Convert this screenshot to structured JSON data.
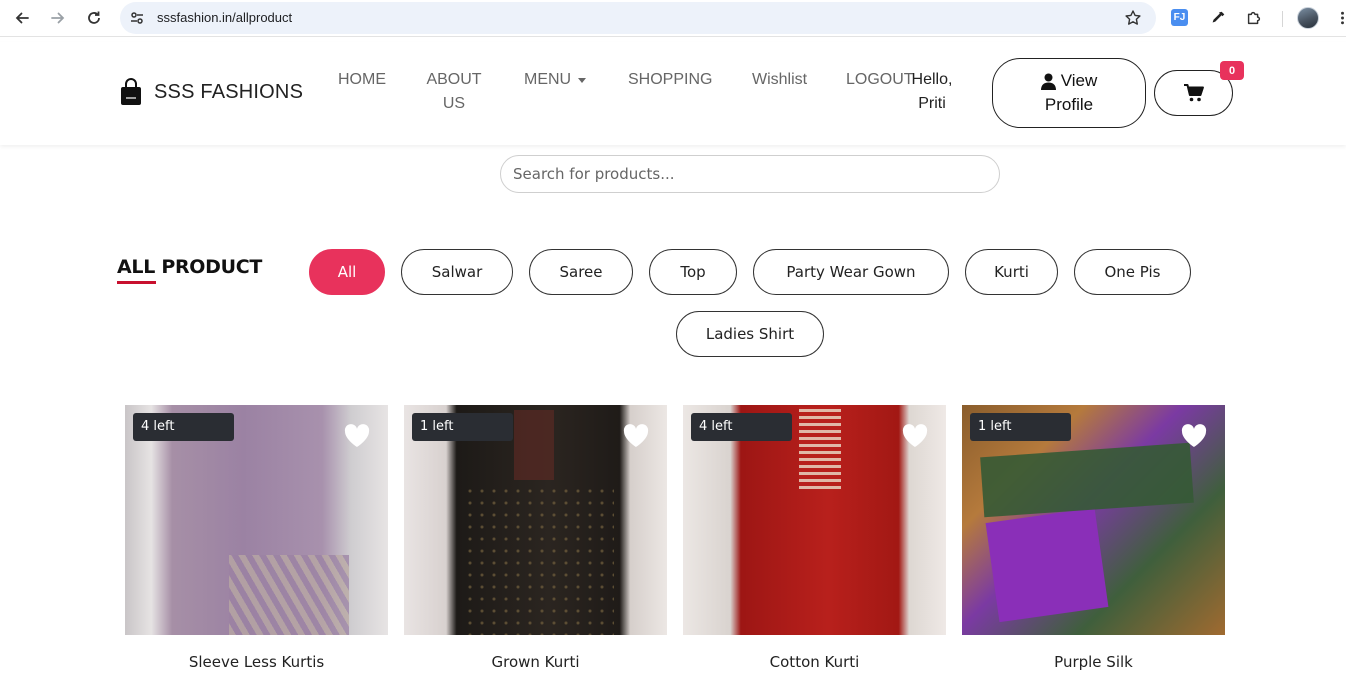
{
  "browser": {
    "url": "sssfashion.in/allproduct",
    "extension_label": "FJ"
  },
  "header": {
    "brand": "SSS FASHIONS",
    "nav": {
      "home": "HOME",
      "about_line1": "ABOUT",
      "about_line2": "US",
      "menu": "MENU",
      "shopping": "SHOPPING",
      "wishlist": "Wishlist",
      "logout": "LOGOUT"
    },
    "greeting_line1": "Hello,",
    "greeting_line2": "Priti",
    "view_profile_line1": "View",
    "view_profile_line2": "Profile",
    "cart_count": "0"
  },
  "search": {
    "placeholder": "Search for products..."
  },
  "section": {
    "title": "ALL PRODUCT"
  },
  "filters": {
    "all": "All",
    "salwar": "Salwar",
    "saree": "Saree",
    "top": "Top",
    "party_wear_gown": "Party Wear Gown",
    "kurti": "Kurti",
    "one_pis": "One Pis",
    "ladies_shirt": "Ladies Shirt",
    "active": "All"
  },
  "products": [
    {
      "stock": "4 left",
      "title": "Sleeve Less Kurtis"
    },
    {
      "stock": "1 left",
      "title": "Grown Kurti"
    },
    {
      "stock": "4 left",
      "title": "Cotton Kurti"
    },
    {
      "stock": "1 left",
      "title": "Purple Silk"
    }
  ],
  "colors": {
    "accent": "#e8325c",
    "underline": "#c8102e",
    "stock_badge": "#2a2d33"
  }
}
